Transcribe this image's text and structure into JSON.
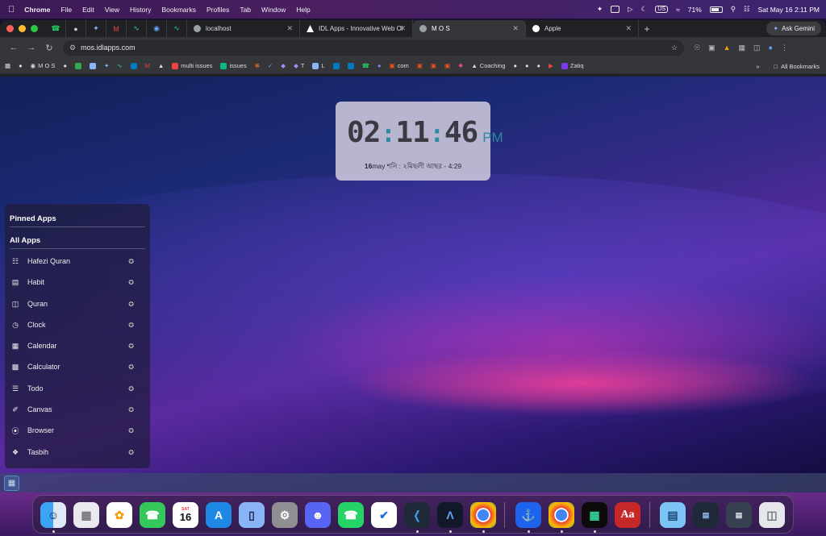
{
  "menubar": {
    "app": "Chrome",
    "items": [
      "File",
      "Edit",
      "View",
      "History",
      "Bookmarks",
      "Profiles",
      "Tab",
      "Window",
      "Help"
    ],
    "input_source": "US",
    "battery": "71%",
    "datetime": "Sat May 16  2:11 PM"
  },
  "tabs": [
    {
      "title": "localhost"
    },
    {
      "title": "IDL Apps - Innovative Web Ol"
    },
    {
      "title": "M O S"
    },
    {
      "title": "Apple"
    }
  ],
  "ask_gemini": "Ask Gemini",
  "address": "mos.idlapps.com",
  "bookmarks": [
    "M O S",
    "multi issues",
    "issues",
    "T",
    "L",
    "com",
    "Coaching",
    "Zatiq"
  ],
  "all_bookmarks": "All Bookmarks",
  "clock": {
    "hh": "02",
    "mm": "11",
    "ss": "46",
    "ampm": "PM",
    "date_prefix": "16",
    "date_rest": "may শনি : ২মিছলী আছর - 4:29"
  },
  "launcher": {
    "pinned_title": "Pinned Apps",
    "all_title": "All Apps",
    "apps": [
      {
        "label": "Hafezi Quran",
        "icon": "book-open-icon"
      },
      {
        "label": "Habit",
        "icon": "calendar-check-icon"
      },
      {
        "label": "Quran",
        "icon": "book-icon"
      },
      {
        "label": "Clock",
        "icon": "clock-icon"
      },
      {
        "label": "Calendar",
        "icon": "calendar-icon"
      },
      {
        "label": "Calculator",
        "icon": "calculator-icon"
      },
      {
        "label": "Todo",
        "icon": "checklist-icon"
      },
      {
        "label": "Canvas",
        "icon": "brush-icon"
      },
      {
        "label": "Browser",
        "icon": "compass-icon"
      },
      {
        "label": "Tasbih",
        "icon": "beads-icon"
      }
    ]
  },
  "dock": {
    "calendar_day": "16",
    "calendar_month": "SAT",
    "dictionary_label": "Aa"
  }
}
